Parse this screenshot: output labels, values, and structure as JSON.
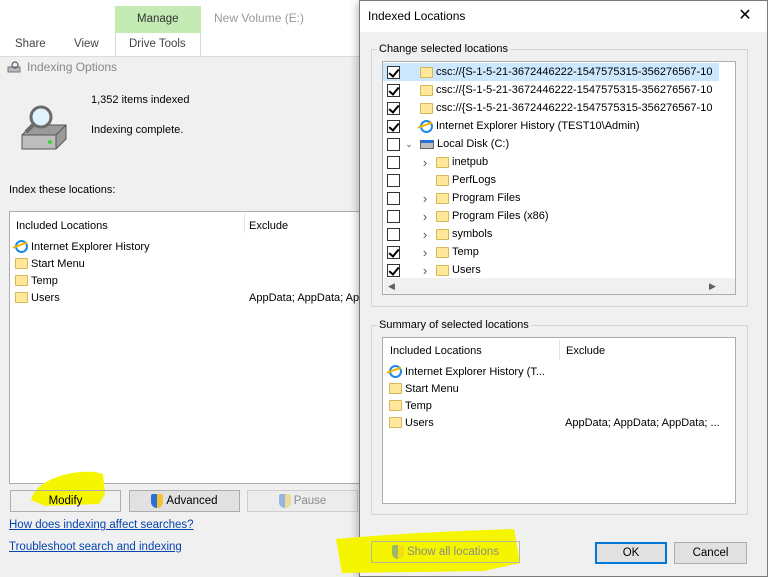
{
  "ribbon": {
    "context_tab": "Manage",
    "context_title": "New Volume (E:)",
    "tabs": [
      "Share",
      "View",
      "Drive Tools"
    ]
  },
  "indexing_options": {
    "title": "Indexing Options",
    "items_indexed": "1,352 items indexed",
    "status": "Indexing complete.",
    "section_label": "Index these locations:",
    "columns": [
      "Included Locations",
      "Exclude"
    ],
    "rows": [
      {
        "icon": "ie-icon",
        "name": "Internet Explorer History",
        "exclude": ""
      },
      {
        "icon": "folder-icon",
        "name": "Start Menu",
        "exclude": ""
      },
      {
        "icon": "folder-icon",
        "name": "Temp",
        "exclude": ""
      },
      {
        "icon": "folder-icon",
        "name": "Users",
        "exclude": "AppData; AppData; Ap"
      }
    ],
    "buttons": {
      "modify": "Modify",
      "advanced": "Advanced",
      "pause": "Pause"
    },
    "links": {
      "help": "How does indexing affect searches?",
      "troubleshoot": "Troubleshoot search and indexing"
    }
  },
  "dialog": {
    "title": "Indexed Locations",
    "change_group": "Change selected locations",
    "tree": [
      {
        "checked": true,
        "expander": "",
        "icon": "folder-icon",
        "label": "csc://{S-1-5-21-3672446222-1547575315-356276567-10",
        "selected": true
      },
      {
        "checked": true,
        "expander": "",
        "icon": "folder-icon",
        "label": "csc://{S-1-5-21-3672446222-1547575315-356276567-10",
        "selected": false
      },
      {
        "checked": true,
        "expander": "",
        "icon": "folder-icon",
        "label": "csc://{S-1-5-21-3672446222-1547575315-356276567-10",
        "selected": false
      },
      {
        "checked": true,
        "expander": "",
        "icon": "ie-icon",
        "label": "Internet Explorer History (TEST10\\Admin)",
        "selected": false
      },
      {
        "checked": false,
        "expander": "open",
        "icon": "drive-icon",
        "label": "Local Disk (C:)",
        "selected": false
      },
      {
        "checked": false,
        "expander": "closed",
        "icon": "folder-icon",
        "label": "inetpub",
        "selected": false
      },
      {
        "checked": false,
        "expander": "",
        "icon": "folder-icon",
        "label": "PerfLogs",
        "selected": false
      },
      {
        "checked": false,
        "expander": "closed",
        "icon": "folder-icon",
        "label": "Program Files",
        "selected": false
      },
      {
        "checked": false,
        "expander": "closed",
        "icon": "folder-icon",
        "label": "Program Files (x86)",
        "selected": false
      },
      {
        "checked": false,
        "expander": "closed",
        "icon": "folder-icon",
        "label": "symbols",
        "selected": false
      },
      {
        "checked": true,
        "expander": "closed",
        "icon": "folder-icon",
        "label": "Temp",
        "selected": false
      },
      {
        "checked": true,
        "expander": "closed",
        "icon": "folder-icon",
        "label": "Users",
        "selected": false
      }
    ],
    "summary_group": "Summary of selected locations",
    "summary_columns": [
      "Included Locations",
      "Exclude"
    ],
    "summary_rows": [
      {
        "icon": "ie-icon",
        "name": "Internet Explorer History (T...",
        "exclude": ""
      },
      {
        "icon": "folder-icon",
        "name": "Start Menu",
        "exclude": ""
      },
      {
        "icon": "folder-icon",
        "name": "Temp",
        "exclude": ""
      },
      {
        "icon": "folder-icon",
        "name": "Users",
        "exclude": "AppData; AppData; AppData; ..."
      }
    ],
    "buttons": {
      "show_all": "Show all locations",
      "ok": "OK",
      "cancel": "Cancel"
    }
  },
  "colors": {
    "highlight": "#f5f500",
    "manage_tab": "#c5ebb5",
    "selection": "#cce8ff",
    "accent": "#0078d7"
  }
}
